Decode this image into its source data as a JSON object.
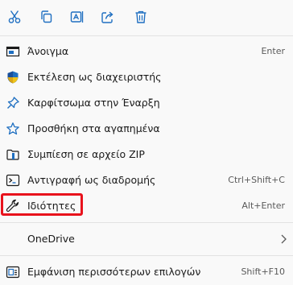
{
  "toolbar": {
    "buttons": [
      {
        "icon": "scissors-icon",
        "name": "cut"
      },
      {
        "icon": "copy-icon",
        "name": "copy"
      },
      {
        "icon": "rename-icon",
        "name": "rename"
      },
      {
        "icon": "share-icon",
        "name": "share"
      },
      {
        "icon": "trash-icon",
        "name": "delete"
      }
    ]
  },
  "menu": {
    "items": [
      {
        "label": "Άνοιγμα",
        "accel": "Enter",
        "icon": "open-icon"
      },
      {
        "label": "Εκτέλεση ως διαχειριστής",
        "accel": "",
        "icon": "shield-icon"
      },
      {
        "label": "Καρφίτσωμα στην Έναρξη",
        "accel": "",
        "icon": "pin-icon"
      },
      {
        "label": "Προσθήκη στα αγαπημένα",
        "accel": "",
        "icon": "star-icon"
      },
      {
        "label": "Συμπίεση σε αρχείο ZIP",
        "accel": "",
        "icon": "zip-icon"
      },
      {
        "label": "Αντιγραφή ως διαδρομής",
        "accel": "Ctrl+Shift+C",
        "icon": "copy-path-icon"
      },
      {
        "label": "Ιδιότητες",
        "accel": "Alt+Enter",
        "icon": "wrench-icon"
      }
    ],
    "onedrive": {
      "label": "OneDrive"
    },
    "more": {
      "label": "Εμφάνιση περισσότερων επιλογών",
      "accel": "Shift+F10",
      "icon": "more-options-icon"
    }
  },
  "colors": {
    "accent": "#0f6cbd",
    "highlight": "#e8121c"
  }
}
